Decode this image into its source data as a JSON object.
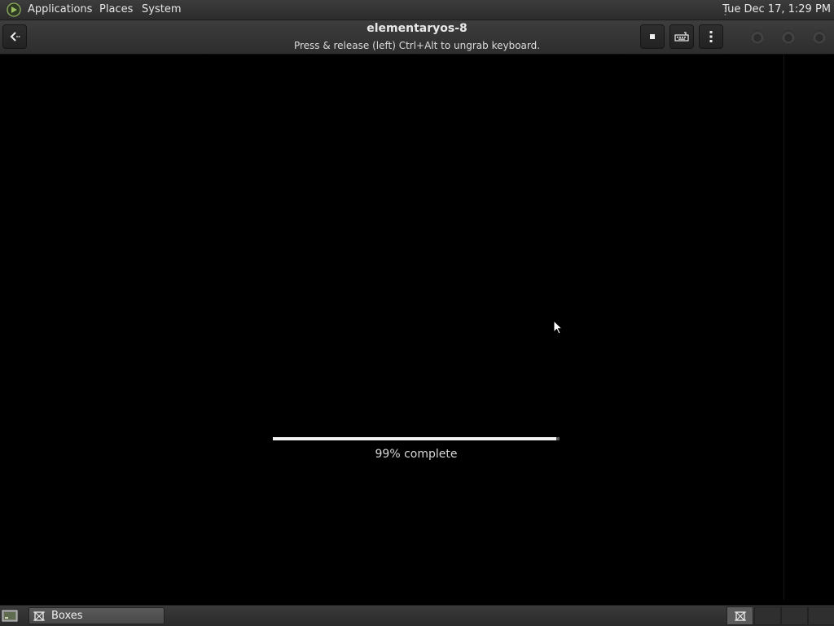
{
  "top_panel": {
    "menus": [
      "Applications",
      "Places",
      "System"
    ],
    "clock": "Tue Dec 17,  1:29 PM"
  },
  "headerbar": {
    "title": "elementaryos-8",
    "subtitle": "Press & release (left) Ctrl+Alt to ungrab keyboard.",
    "icons": {
      "back": "back-arrow-icon",
      "stop": "stop-icon",
      "keyboard": "keyboard-icon",
      "menu": "kebab-menu-icon"
    }
  },
  "vm": {
    "progress_fraction": 0.99,
    "progress_label": "99% complete"
  },
  "bottom_panel": {
    "task_label": "Boxes",
    "workspaces": 4,
    "active_workspace": 1
  },
  "colors": {
    "panel": "#333333",
    "progress_fill": "#f2f2f2",
    "vm_background": "#000000"
  }
}
